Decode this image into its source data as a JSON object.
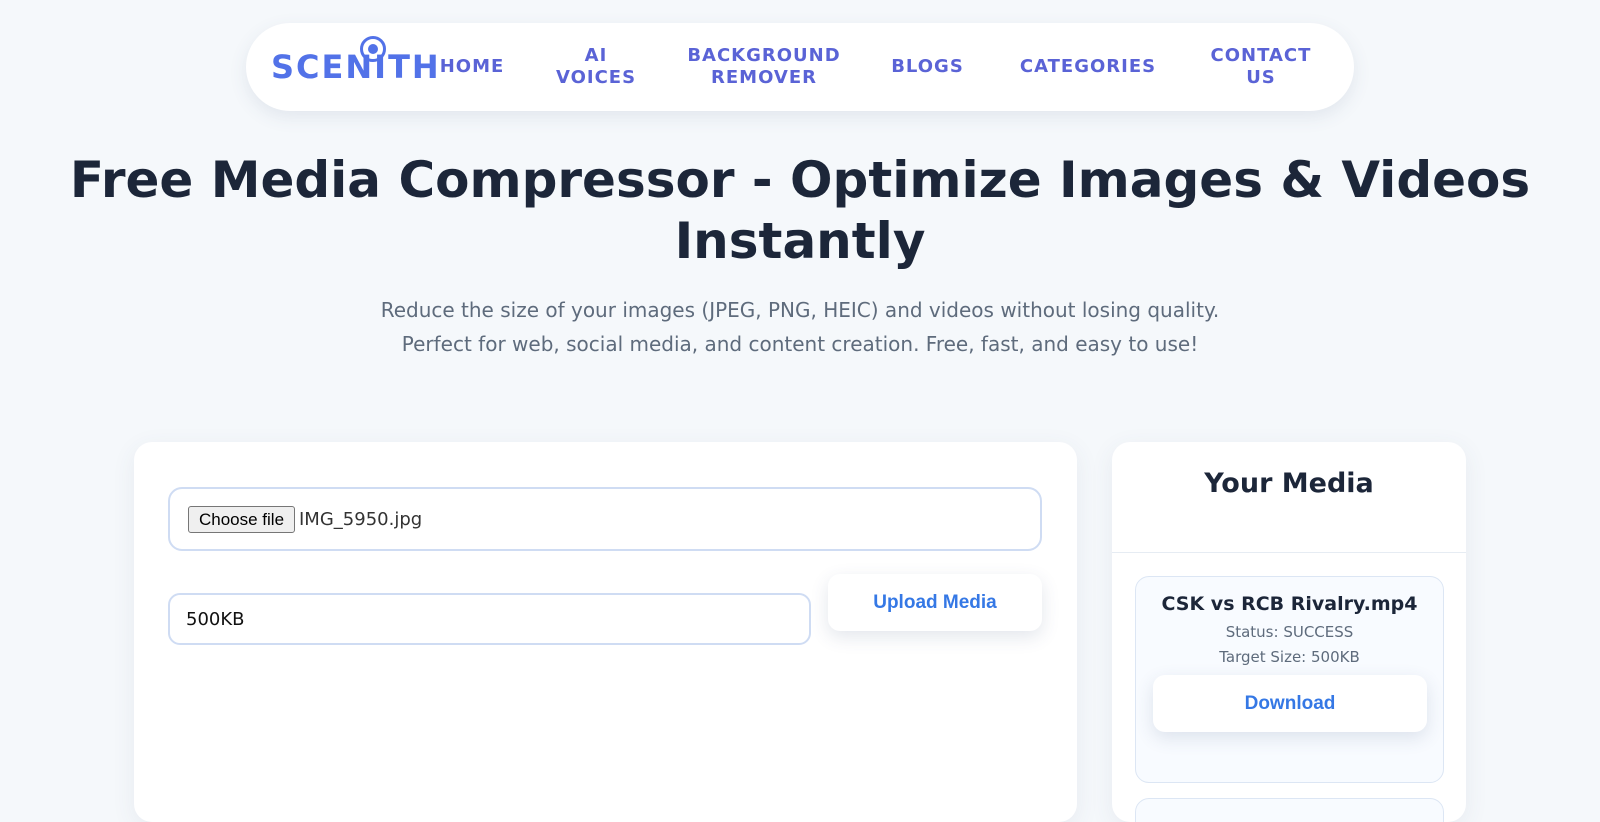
{
  "brand": {
    "logo_text": "SCENITH",
    "accent_color": "#5272e8",
    "nav_color": "#5a63d6",
    "button_text_color": "#3578e5"
  },
  "nav": {
    "items": [
      {
        "line1": "HOME",
        "line2": ""
      },
      {
        "line1": "AI",
        "line2": "VOICES"
      },
      {
        "line1": "BACKGROUND",
        "line2": "REMOVER"
      },
      {
        "line1": "BLOGS",
        "line2": ""
      },
      {
        "line1": "CATEGORIES",
        "line2": ""
      },
      {
        "line1": "CONTACT",
        "line2": "US"
      }
    ]
  },
  "hero": {
    "title": "Free Media Compressor - Optimize Images & Videos Instantly",
    "subtitle": "Reduce the size of your images (JPEG, PNG, HEIC) and videos without losing quality. Perfect for web, social media, and content creation. Free, fast, and easy to use!"
  },
  "uploader": {
    "choose_file_label": "Choose file",
    "file_name": "IMG_5950.jpg",
    "target_size_value": "500KB",
    "upload_label": "Upload Media"
  },
  "media_panel": {
    "title": "Your Media",
    "items": [
      {
        "name": "CSK vs RCB Rivalry.mp4",
        "status": "Status: SUCCESS",
        "target": "Target Size: 500KB",
        "download_label": "Download"
      }
    ]
  }
}
